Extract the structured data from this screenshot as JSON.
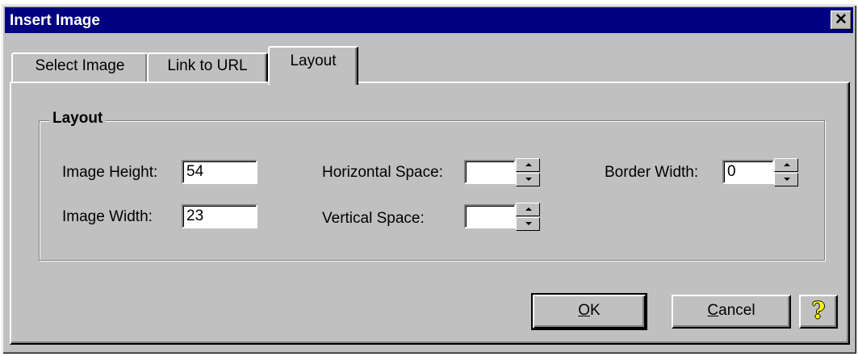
{
  "dialog": {
    "title": "Insert Image",
    "close_glyph": "✕"
  },
  "tabs": [
    {
      "label": "Select Image",
      "active": false
    },
    {
      "label": "Link to URL",
      "active": false
    },
    {
      "label": "Layout",
      "active": true
    }
  ],
  "layout_group": {
    "label": "Layout",
    "image_height": {
      "label": "Image Height:",
      "value": "54"
    },
    "image_width": {
      "label": "Image Width:",
      "value": "23"
    },
    "horizontal_space": {
      "label": "Horizontal Space:",
      "value": ""
    },
    "vertical_space": {
      "label": "Vertical Space:",
      "value": ""
    },
    "border_width": {
      "label": "Border Width:",
      "value": "0"
    }
  },
  "buttons": {
    "ok": {
      "mnemonic": "O",
      "rest": "K"
    },
    "cancel": {
      "mnemonic": "C",
      "rest": "ancel"
    },
    "help_icon": "question-mark-icon",
    "help_glyph": "?"
  },
  "colors": {
    "titlebar": "#000080",
    "face": "#c0c0c0",
    "help_glyph": "#ffff00"
  }
}
